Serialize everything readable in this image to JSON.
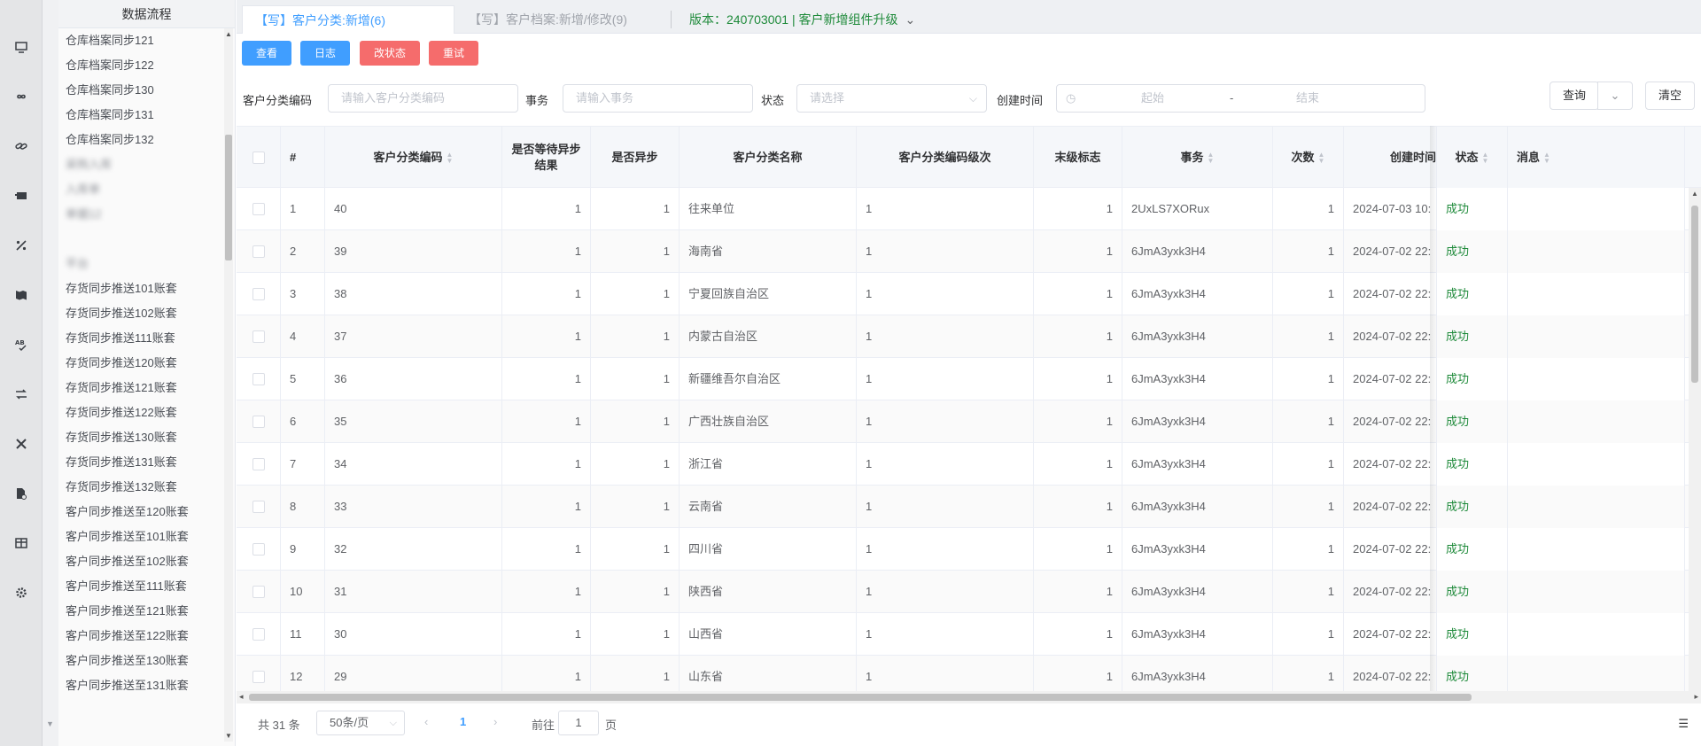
{
  "sidebar": {
    "title": "数据流程",
    "items": [
      {
        "label": "仓库档案同步121",
        "blur": false
      },
      {
        "label": "仓库档案同步122",
        "blur": false
      },
      {
        "label": "仓库档案同步130",
        "blur": false
      },
      {
        "label": "仓库档案同步131",
        "blur": false
      },
      {
        "label": "仓库档案同步132",
        "blur": false
      },
      {
        "label": "采购入库",
        "blur": true
      },
      {
        "label": "入库单",
        "blur": true
      },
      {
        "label": "单据12",
        "blur": true
      },
      {
        "label": "",
        "blur": true
      },
      {
        "label": "平台",
        "blur": true
      },
      {
        "label": "存货同步推送101账套",
        "blur": false
      },
      {
        "label": "存货同步推送102账套",
        "blur": false
      },
      {
        "label": "存货同步推送111账套",
        "blur": false
      },
      {
        "label": "存货同步推送120账套",
        "blur": false
      },
      {
        "label": "存货同步推送121账套",
        "blur": false
      },
      {
        "label": "存货同步推送122账套",
        "blur": false
      },
      {
        "label": "存货同步推送130账套",
        "blur": false
      },
      {
        "label": "存货同步推送131账套",
        "blur": false
      },
      {
        "label": "存货同步推送132账套",
        "blur": false
      },
      {
        "label": "客户同步推送至120账套",
        "blur": false
      },
      {
        "label": "客户同步推送至101账套",
        "blur": false
      },
      {
        "label": "客户同步推送至102账套",
        "blur": false
      },
      {
        "label": "客户同步推送至111账套",
        "blur": false
      },
      {
        "label": "客户同步推送至121账套",
        "blur": false
      },
      {
        "label": "客户同步推送至122账套",
        "blur": false
      },
      {
        "label": "客户同步推送至130账套",
        "blur": false
      },
      {
        "label": "客户同步推送至131账套",
        "blur": false
      }
    ]
  },
  "rail_icons": [
    "monitor-icon",
    "infinity-icon",
    "link-icon",
    "card-icon",
    "percent-icon",
    "map-icon",
    "spellcheck-icon",
    "swap-icon",
    "tools-icon",
    "file-settings-icon",
    "table-icon",
    "gear-icon"
  ],
  "tabs": {
    "active": "【写】客户分类:新增(6)",
    "inactive": "【写】客户档案:新增/修改(9)",
    "version": "版本：240703001 | 客户新增组件升级"
  },
  "toolbar": {
    "view": "查看",
    "log": "日志",
    "change_status": "改状态",
    "retry": "重试"
  },
  "filters": {
    "code_label": "客户分类编码",
    "code_placeholder": "请输入客户分类编码",
    "txn_label": "事务",
    "txn_placeholder": "请输入事务",
    "status_label": "状态",
    "status_placeholder": "请选择",
    "created_label": "创建时间",
    "start_placeholder": "起始",
    "range_sep": "-",
    "end_placeholder": "结束",
    "query": "查询",
    "clear": "清空"
  },
  "table": {
    "headers": {
      "index": "#",
      "code": "客户分类编码",
      "wait_async": "是否等待异步结果",
      "is_async": "是否异步",
      "name": "客户分类名称",
      "level": "客户分类编码级次",
      "leaf": "末级标志",
      "txn": "事务",
      "count": "次数",
      "created": "创建时间",
      "status": "状态",
      "message": "消息"
    },
    "rows": [
      {
        "idx": "1",
        "code": "40",
        "wait": "1",
        "async": "1",
        "name": "往来单位",
        "level": "1",
        "leaf": "1",
        "txn": "2UxLS7XORux",
        "count": "1",
        "created": "2024-07-03 10:",
        "status": "成功",
        "msg": ""
      },
      {
        "idx": "2",
        "code": "39",
        "wait": "1",
        "async": "1",
        "name": "海南省",
        "level": "1",
        "leaf": "1",
        "txn": "6JmA3yxk3H4",
        "count": "1",
        "created": "2024-07-02 22:",
        "status": "成功",
        "msg": ""
      },
      {
        "idx": "3",
        "code": "38",
        "wait": "1",
        "async": "1",
        "name": "宁夏回族自治区",
        "level": "1",
        "leaf": "1",
        "txn": "6JmA3yxk3H4",
        "count": "1",
        "created": "2024-07-02 22:",
        "status": "成功",
        "msg": ""
      },
      {
        "idx": "4",
        "code": "37",
        "wait": "1",
        "async": "1",
        "name": "内蒙古自治区",
        "level": "1",
        "leaf": "1",
        "txn": "6JmA3yxk3H4",
        "count": "1",
        "created": "2024-07-02 22:",
        "status": "成功",
        "msg": ""
      },
      {
        "idx": "5",
        "code": "36",
        "wait": "1",
        "async": "1",
        "name": "新疆维吾尔自治区",
        "level": "1",
        "leaf": "1",
        "txn": "6JmA3yxk3H4",
        "count": "1",
        "created": "2024-07-02 22:",
        "status": "成功",
        "msg": ""
      },
      {
        "idx": "6",
        "code": "35",
        "wait": "1",
        "async": "1",
        "name": "广西壮族自治区",
        "level": "1",
        "leaf": "1",
        "txn": "6JmA3yxk3H4",
        "count": "1",
        "created": "2024-07-02 22:",
        "status": "成功",
        "msg": ""
      },
      {
        "idx": "7",
        "code": "34",
        "wait": "1",
        "async": "1",
        "name": "浙江省",
        "level": "1",
        "leaf": "1",
        "txn": "6JmA3yxk3H4",
        "count": "1",
        "created": "2024-07-02 22:",
        "status": "成功",
        "msg": ""
      },
      {
        "idx": "8",
        "code": "33",
        "wait": "1",
        "async": "1",
        "name": "云南省",
        "level": "1",
        "leaf": "1",
        "txn": "6JmA3yxk3H4",
        "count": "1",
        "created": "2024-07-02 22:",
        "status": "成功",
        "msg": ""
      },
      {
        "idx": "9",
        "code": "32",
        "wait": "1",
        "async": "1",
        "name": "四川省",
        "level": "1",
        "leaf": "1",
        "txn": "6JmA3yxk3H4",
        "count": "1",
        "created": "2024-07-02 22:",
        "status": "成功",
        "msg": ""
      },
      {
        "idx": "10",
        "code": "31",
        "wait": "1",
        "async": "1",
        "name": "陕西省",
        "level": "1",
        "leaf": "1",
        "txn": "6JmA3yxk3H4",
        "count": "1",
        "created": "2024-07-02 22:",
        "status": "成功",
        "msg": ""
      },
      {
        "idx": "11",
        "code": "30",
        "wait": "1",
        "async": "1",
        "name": "山西省",
        "level": "1",
        "leaf": "1",
        "txn": "6JmA3yxk3H4",
        "count": "1",
        "created": "2024-07-02 22:",
        "status": "成功",
        "msg": ""
      },
      {
        "idx": "12",
        "code": "29",
        "wait": "1",
        "async": "1",
        "name": "山东省",
        "level": "1",
        "leaf": "1",
        "txn": "6JmA3yxk3H4",
        "count": "1",
        "created": "2024-07-02 22:",
        "status": "成功",
        "msg": ""
      }
    ]
  },
  "pager": {
    "total": "共 31 条",
    "page_size": "50条/页",
    "current": "1",
    "goto_label": "前往",
    "goto_value": "1",
    "page_unit": "页"
  },
  "colors": {
    "primary": "#409eff",
    "danger": "#f56c6c",
    "success": "#1e8a3a"
  }
}
